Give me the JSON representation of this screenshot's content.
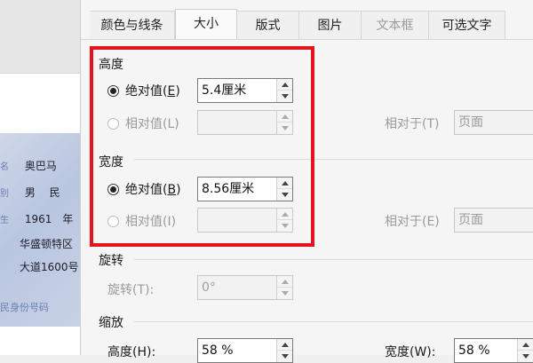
{
  "document_card": {
    "rows": [
      {
        "label": "名",
        "value": "奥巴马"
      },
      {
        "label": "别",
        "value": "男　 民"
      },
      {
        "label": "生",
        "value": "1961　年"
      },
      {
        "label": "",
        "value": "华盛顿特区"
      },
      {
        "label": "",
        "value": "大道1600号"
      }
    ],
    "footer": "民身份号码"
  },
  "tabs": [
    {
      "label": "颜色与线条",
      "active": false,
      "disabled": false
    },
    {
      "label": "大小",
      "active": true,
      "disabled": false
    },
    {
      "label": "版式",
      "active": false,
      "disabled": false
    },
    {
      "label": "图片",
      "active": false,
      "disabled": false
    },
    {
      "label": "文本框",
      "active": false,
      "disabled": true
    },
    {
      "label": "可选文字",
      "active": false,
      "disabled": false
    }
  ],
  "height": {
    "title": "高度",
    "absolute_label": "绝对值(",
    "absolute_key": "E",
    "absolute_value": "5.4厘米",
    "relative_label": "相对值(L)",
    "relative_value": "",
    "relative_to_label": "相对于(T)",
    "relative_to_value": "页面"
  },
  "width": {
    "title": "宽度",
    "absolute_label": "绝对值(",
    "absolute_key": "B",
    "absolute_value": "8.56厘米",
    "relative_label": "相对值(I)",
    "relative_value": "",
    "relative_to_label": "相对于(E)",
    "relative_to_value": "页面"
  },
  "rotation": {
    "title": "旋转",
    "label": "旋转(T):",
    "value": "0°"
  },
  "scale": {
    "title": "缩放",
    "height_label": "高度(H):",
    "height_value": "58 %",
    "width_label": "宽度(W):",
    "width_value": "58 %"
  },
  "colors": {
    "highlight": "#e5141c"
  }
}
